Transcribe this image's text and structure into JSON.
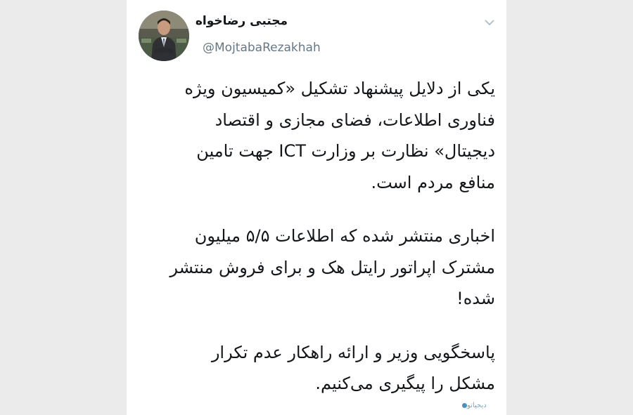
{
  "tweet": {
    "author": {
      "display_name": "مجتبی رضاخواه",
      "handle": "@MojtabaRezakhah"
    },
    "menu_icon": "chevron-down-icon",
    "paragraphs": [
      {
        "lines": [
          "یکی از دلایل پیشنهاد تشکیل «کمیسیون ویژه",
          "فناوری اطلاعات، فضای مجازی و اقتصاد",
          "دیجیتال» نظارت بر وزارت ICT جهت تامین",
          "منافع مردم است."
        ]
      },
      {
        "lines": [
          "اخباری منتشر شده که اطلاعات ۵/۵ میلیون",
          "مشترک اپراتور رایتل هک و برای فروش منتشر",
          "شده!"
        ]
      },
      {
        "lines": [
          "پاسخگویی وزیر و ارائه راهکار عدم تکرار",
          "مشکل را پیگیری می‌کنیم."
        ]
      }
    ]
  },
  "watermark": {
    "text": "دیجیاتو"
  },
  "colors": {
    "page_background": "#ebebeb",
    "card_background": "#ffffff",
    "text_primary": "#14171a",
    "text_secondary": "#657786",
    "watermark": "#7fa7c4"
  }
}
